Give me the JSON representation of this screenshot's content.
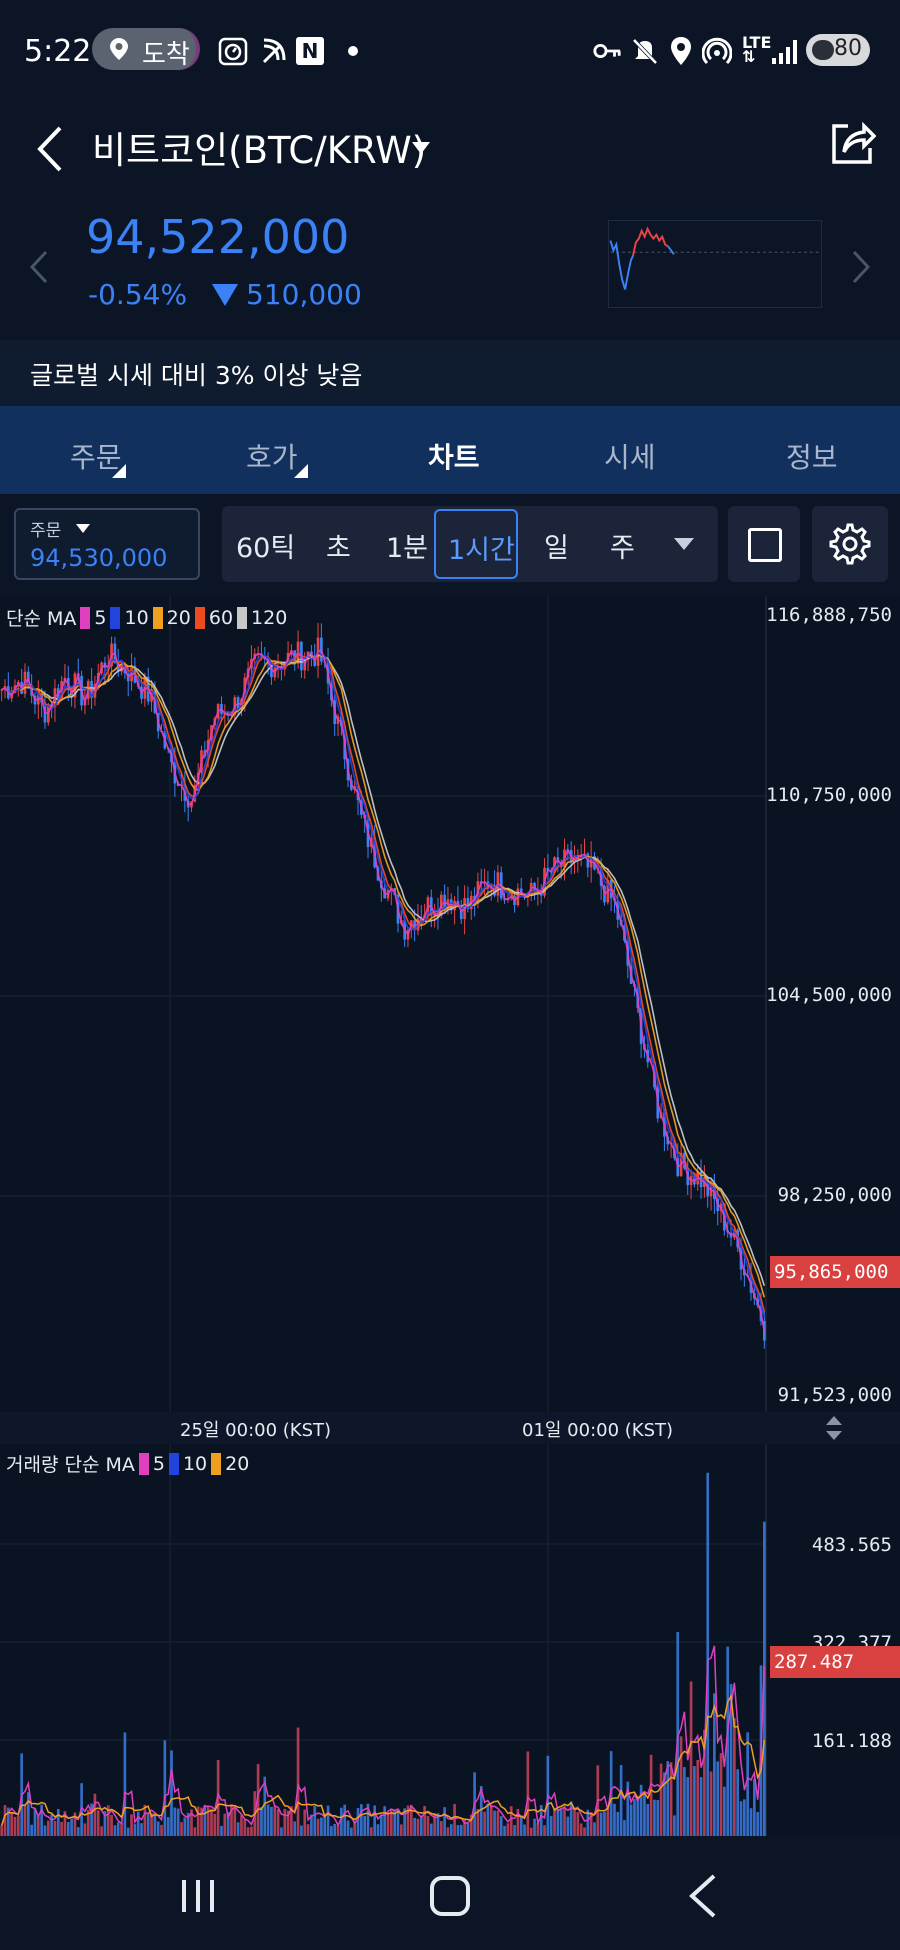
{
  "status": {
    "time": "5:22",
    "location_label": "도착",
    "notification_letter": "N",
    "network": "LTE",
    "battery": "80"
  },
  "header": {
    "title": "비트코인(BTC/KRW)",
    "price": "94,522,000",
    "change_pct": "-0.54%",
    "change_value": "510,000",
    "change_direction": "down"
  },
  "notice": "글로벌 시세 대비 3% 이상 낮음",
  "tabs": [
    {
      "label": "주문",
      "active": false,
      "has_menu": true
    },
    {
      "label": "호가",
      "active": false,
      "has_menu": true
    },
    {
      "label": "차트",
      "active": true,
      "has_menu": false
    },
    {
      "label": "시세",
      "active": false,
      "has_menu": false
    },
    {
      "label": "정보",
      "active": false,
      "has_menu": false
    }
  ],
  "toolbar": {
    "order_label": "주문",
    "order_price": "94,530,000",
    "intervals": [
      "60틱",
      "초",
      "1분",
      "1시간",
      "일",
      "주"
    ],
    "active_interval": "1시간"
  },
  "chart_data": {
    "type": "candlestick",
    "price_legend": {
      "label": "단순 MA",
      "periods": [
        "5",
        "10",
        "20",
        "60",
        "120"
      ],
      "colors": [
        "#e040c0",
        "#2244dd",
        "#f0a020",
        "#f04a20",
        "#c8c8c8"
      ]
    },
    "price_ticks": [
      "116,888,750",
      "110,750,000",
      "104,500,000",
      "98,250,000",
      "91,523,000"
    ],
    "current_price_tag": "95,865,000",
    "time_labels": [
      "25일 00:00 (KST)",
      "01일 00:00 (KST)"
    ],
    "volume_legend": {
      "label": "거래량 단순 MA",
      "periods": [
        "5",
        "10",
        "20"
      ],
      "colors": [
        "#e040c0",
        "#2244dd",
        "#f0a020"
      ]
    },
    "volume_ticks": [
      "483.565",
      "322.377",
      "161.188"
    ],
    "current_volume_tag": "287.487",
    "price_series_trend": [
      114.5,
      114.8,
      113.8,
      114.9,
      114.2,
      115.6,
      115.1,
      114.3,
      112.0,
      110.9,
      113.6,
      114.0,
      115.3,
      115.4,
      115.6,
      115.7,
      113.0,
      110.2,
      108.3,
      106.8,
      107.4,
      107.8,
      107.4,
      108.3,
      108.0,
      107.8,
      108.6,
      109.0,
      108.5,
      107.4,
      104.0,
      100.8,
      99.0,
      98.6,
      97.4,
      95.9,
      93.8
    ]
  }
}
